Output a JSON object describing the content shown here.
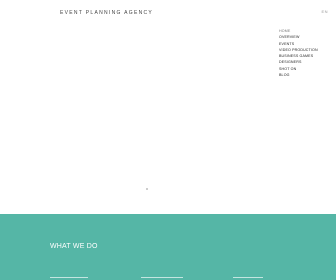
{
  "header": {
    "brand": "EVENT PLANNING AGENCY",
    "language": "EN"
  },
  "menu": {
    "items": [
      {
        "label": "HOME"
      },
      {
        "label": "OVERVIEW"
      },
      {
        "label": "EVENTS"
      },
      {
        "label": "VIDEO PRODUCTION"
      },
      {
        "label": "BUSINESS GAMES"
      },
      {
        "label": "DESIGNERS"
      },
      {
        "label": "SHOT ON"
      },
      {
        "label": "BLOG"
      }
    ]
  },
  "section": {
    "title": "WHAT WE DO",
    "background": "#55b6a6"
  }
}
